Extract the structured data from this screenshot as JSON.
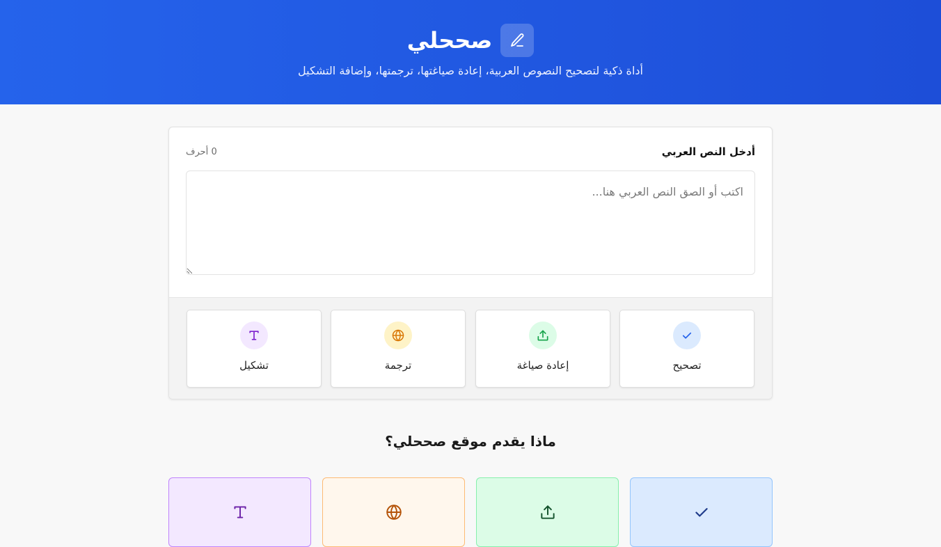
{
  "header": {
    "app_name": "صححلي",
    "logo_icon": "pencil-icon",
    "tagline": "أداة ذكية لتصحيح النصوص العربية، إعادة صياغتها، ترجمتها، وإضافة التشكيل"
  },
  "editor": {
    "label": "أدخل النص العربي",
    "char_count": "0 أحرف",
    "value": "",
    "placeholder": "اكتب أو الصق النص العربي هنا..."
  },
  "actions": [
    {
      "label": "تصحيح",
      "icon": "check-icon",
      "color": "#2563eb",
      "bg": "#dbeafe"
    },
    {
      "label": "إعادة صياغة",
      "icon": "upload-icon",
      "color": "#16a34a",
      "bg": "#dcfce7"
    },
    {
      "label": "ترجمة",
      "icon": "globe-icon",
      "color": "#d97706",
      "bg": "#fef3c7"
    },
    {
      "label": "تشكيل",
      "icon": "text-icon",
      "color": "#7e22ce",
      "bg": "#f3e8ff"
    }
  ],
  "features": {
    "title": "ماذا يقدم موقع صححلي؟",
    "cards": [
      {
        "icon": "check-icon",
        "color": "#1e3a8a",
        "bg": "#dbeafe",
        "border": "#93c5fd"
      },
      {
        "icon": "upload-icon",
        "color": "#14532d",
        "bg": "#dcfce7",
        "border": "#86efac"
      },
      {
        "icon": "globe-icon",
        "color": "#b45309",
        "bg": "#fff7ed",
        "border": "#fdba74"
      },
      {
        "icon": "text-icon",
        "color": "#6b21a8",
        "bg": "#f3e8ff",
        "border": "#c084fc"
      }
    ]
  }
}
